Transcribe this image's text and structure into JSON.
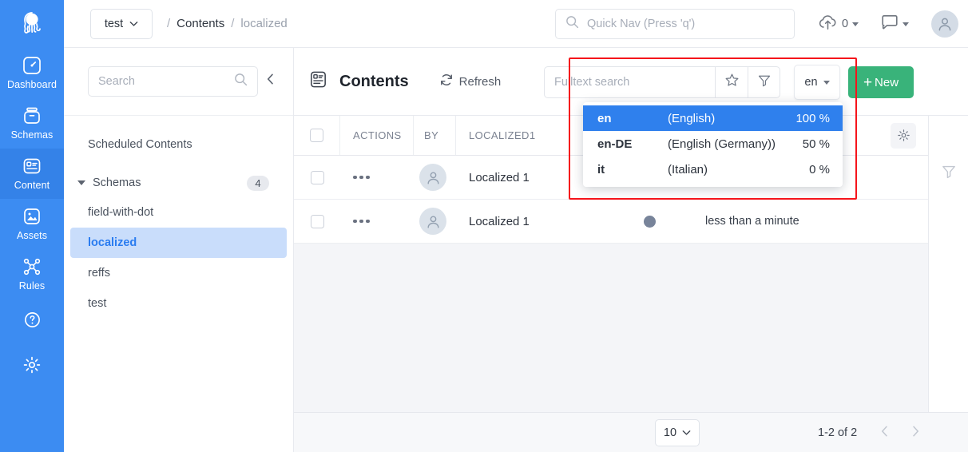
{
  "nav": {
    "logo_icon": "squidex-octopus-logo-icon",
    "items": [
      {
        "label": "Dashboard",
        "icon": "dashboard-gauge-icon",
        "active": false
      },
      {
        "label": "Schemas",
        "icon": "schemas-box-icon",
        "active": false
      },
      {
        "label": "Content",
        "icon": "content-document-icon",
        "active": true
      },
      {
        "label": "Assets",
        "icon": "assets-image-icon",
        "active": false
      },
      {
        "label": "Rules",
        "icon": "rules-nodes-icon",
        "active": false
      }
    ],
    "mini_items": [
      {
        "icon": "help-circle-icon"
      },
      {
        "icon": "settings-gear-icon"
      }
    ]
  },
  "header": {
    "project": "test",
    "breadcrumb": {
      "sep1": "/",
      "contents": "Contents",
      "sep2": "/",
      "current": "localized"
    },
    "quick_nav_placeholder": "Quick Nav (Press 'q')",
    "search_icon": "search-icon",
    "upload_icon": "cloud-upload-icon",
    "upload_count": "0",
    "notifications_icon": "chat-bubble-icon",
    "avatar_icon": "user-avatar-icon"
  },
  "sidebar": {
    "search_placeholder": "Search",
    "search_icon": "search-icon",
    "collapse_icon": "chevron-left-icon",
    "scheduled_contents": "Scheduled Contents",
    "schemas_label": "Schemas",
    "schemas_count": "4",
    "schemas": [
      {
        "label": "field-with-dot",
        "selected": false
      },
      {
        "label": "localized",
        "selected": true
      },
      {
        "label": "reffs",
        "selected": false
      },
      {
        "label": "test",
        "selected": false
      }
    ]
  },
  "toolbar": {
    "title_icon": "content-document-icon",
    "title": "Contents",
    "refresh_icon": "refresh-icon",
    "refresh_label": "Refresh",
    "fulltext_placeholder": "Fulltext search",
    "star_icon": "star-icon",
    "filter_icon": "funnel-filter-icon",
    "language": "en",
    "new_plus": "+",
    "new_label": "New",
    "new_color": "#39b37a"
  },
  "language_dropdown": {
    "highlight_color": "#f5141b",
    "selected_bg": "#2f80ed",
    "options": [
      {
        "code": "en",
        "name": "(English)",
        "percent": "100 %",
        "selected": true
      },
      {
        "code": "en-DE",
        "name": "(English (Germany))",
        "percent": "50 %",
        "selected": false
      },
      {
        "code": "it",
        "name": "(Italian)",
        "percent": "0 %",
        "selected": false
      }
    ]
  },
  "table": {
    "columns": {
      "actions": "ACTIONS",
      "by": "BY",
      "localized1": "LOCALIZED1"
    },
    "settings_icon": "gear-icon",
    "rail_filter_icon": "funnel-filter-icon",
    "rows": [
      {
        "title": "Localized 1",
        "avatar_icon": "user-avatar-icon",
        "actions_icon": "ellipsis-icon",
        "status_color": "#78849a",
        "time": ""
      },
      {
        "title": "Localized 1",
        "avatar_icon": "user-avatar-icon",
        "actions_icon": "ellipsis-icon",
        "status_color": "#78849a",
        "time": "less than a minute"
      }
    ]
  },
  "footer": {
    "page_size": "10",
    "page_info": "1-2 of 2",
    "prev_icon": "chevron-left-icon",
    "next_icon": "chevron-right-icon"
  }
}
